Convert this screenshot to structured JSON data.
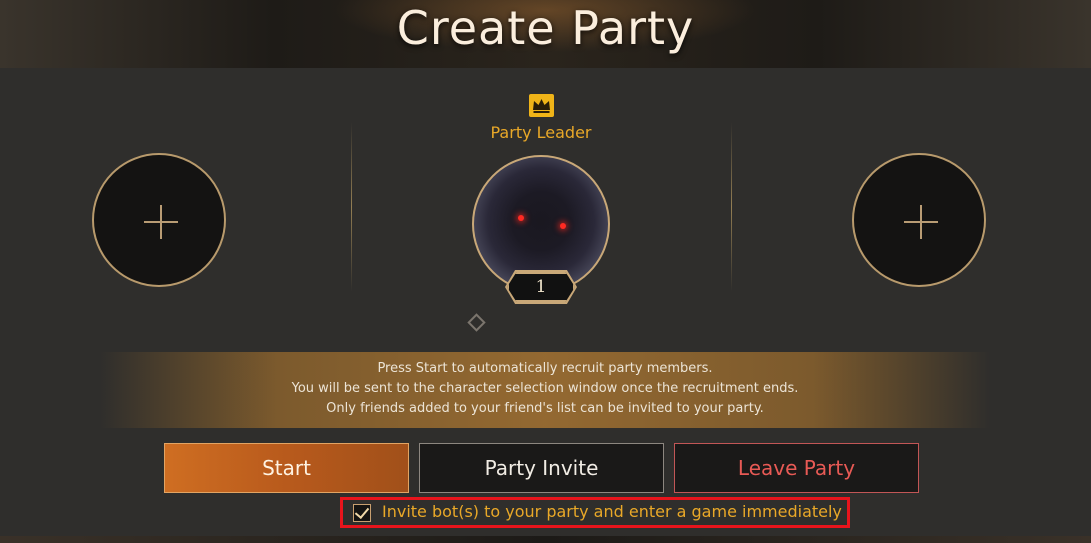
{
  "header": {
    "title": "Create Party"
  },
  "party": {
    "leader_label": "Party Leader",
    "leader_level": "1",
    "slots": [
      "add-member",
      "add-member"
    ]
  },
  "info": {
    "lines": [
      "Press Start to automatically recruit party members.",
      "You will be sent to the character selection window once the recruitment ends.",
      "Only friends added to your friend's list can be invited to your party."
    ]
  },
  "buttons": {
    "start": "Start",
    "invite": "Party Invite",
    "leave": "Leave Party"
  },
  "bot_option": {
    "label": "Invite bot(s) to your party and enter a game immediately",
    "checked": true
  },
  "colors": {
    "accent_gold": "#e9a828",
    "start_orange": "#cf6e22",
    "leave_red": "#e85a55",
    "highlight_red": "#e8141c"
  },
  "icons": [
    "crown-icon",
    "plus-icon",
    "diamond-icon",
    "checkmark-icon"
  ]
}
